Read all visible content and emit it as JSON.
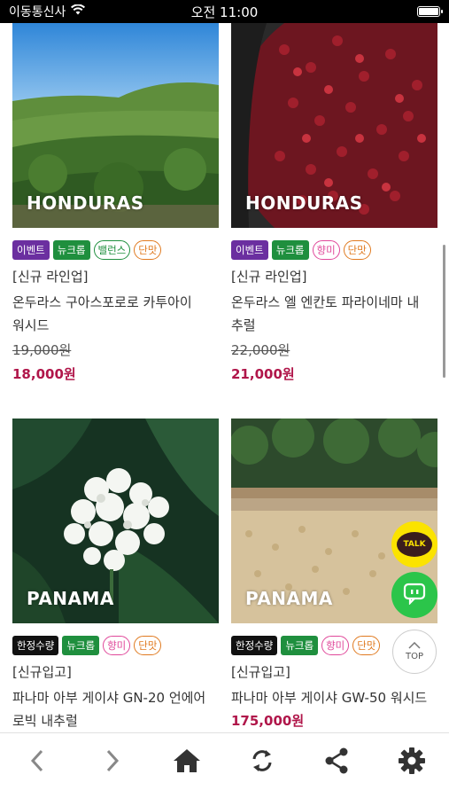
{
  "status_bar": {
    "carrier": "이동통신사",
    "time": "오전 11:00"
  },
  "products": [
    {
      "origin_label": "HONDURAS",
      "badges": [
        "이벤트",
        "뉴크롭",
        "밸런스",
        "단맛"
      ],
      "line_tag": "[신규 라인업]",
      "name_line1": "온두라스 구아스포로로 카투아이",
      "name_line2": "워시드",
      "original_price": "19,000원",
      "price": "18,000원"
    },
    {
      "origin_label": "HONDURAS",
      "badges": [
        "이벤트",
        "뉴크롭",
        "향미",
        "단맛"
      ],
      "line_tag": "[신규 라인업]",
      "name_line1": "온두라스 엘 엔칸토 파라이네마 내",
      "name_line2": "추럴",
      "original_price": "22,000원",
      "price": "21,000원"
    },
    {
      "origin_label": "PANAMA",
      "badges": [
        "한정수량",
        "뉴크롭",
        "향미",
        "단맛"
      ],
      "line_tag": "[신규입고]",
      "name_line1": "파나마 아부 게이샤 GN-20 언에어",
      "name_line2": "로빅 내추럴"
    },
    {
      "origin_label": "PANAMA",
      "badges": [
        "한정수량",
        "뉴크롭",
        "향미",
        "단맛"
      ],
      "line_tag": "[신규입고]",
      "name_line1": "파나마 아부 게이샤 GW-50 워시드",
      "price": "175,000원"
    }
  ],
  "floating": {
    "talk_label": "TALK",
    "top_label": "TOP"
  },
  "bottom_nav": [
    "back-icon",
    "forward-icon",
    "home-icon",
    "refresh-icon",
    "share-icon",
    "settings-icon"
  ]
}
